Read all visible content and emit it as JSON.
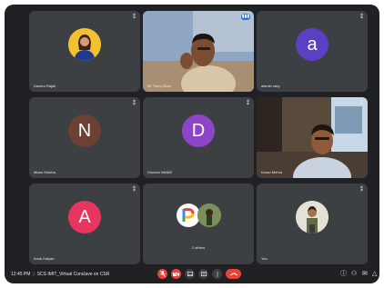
{
  "tiles": [
    {
      "name": "Kanuru Rajak"
    },
    {
      "name": "Mr Tinny Khan"
    },
    {
      "name": "alamin nary",
      "avatar_letter": "a",
      "avatar_color": "#5b3fc4"
    },
    {
      "name": "Mban Shutha",
      "avatar_letter": "N",
      "avatar_color": "#6d4034"
    },
    {
      "name": "Director MM&E",
      "avatar_letter": "D",
      "avatar_color": "#8e44c7"
    },
    {
      "name": "Karan Mehra"
    },
    {
      "name": "Anuk Kalyan",
      "avatar_letter": "A",
      "avatar_color": "#e8355f"
    },
    {
      "name": "2 others"
    },
    {
      "name": "You"
    }
  ],
  "bottom_bar": {
    "time": "12:45 PM",
    "meeting_title": "SCS IMIT_Virtual Conclave on CSR"
  },
  "icons": {
    "mic_off": "mic-off-icon",
    "cam_off": "camera-off-icon",
    "captions": "captions-icon",
    "present": "present-icon",
    "more": "more-options-icon",
    "end": "end-call-icon",
    "info": "info-icon",
    "people": "people-icon",
    "chat": "chat-icon",
    "activities": "activities-icon"
  },
  "colors": {
    "background": "#202124",
    "tile": "#3c4043",
    "danger": "#ea4335",
    "accent": "#1a73e8"
  }
}
